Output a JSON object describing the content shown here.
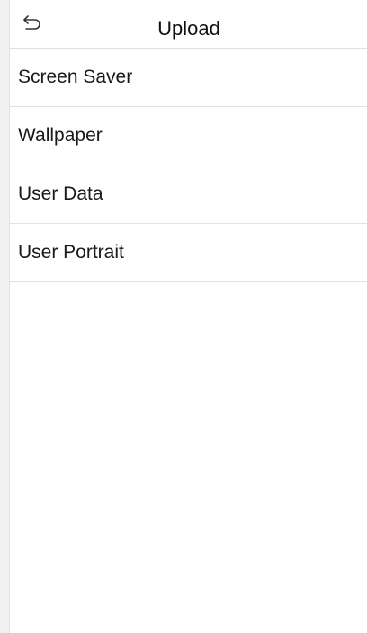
{
  "header": {
    "title": "Upload",
    "back_icon": "back-arrow-icon"
  },
  "menu": {
    "items": [
      {
        "label": "Screen Saver"
      },
      {
        "label": "Wallpaper"
      },
      {
        "label": "User Data"
      },
      {
        "label": "User Portrait"
      }
    ]
  }
}
